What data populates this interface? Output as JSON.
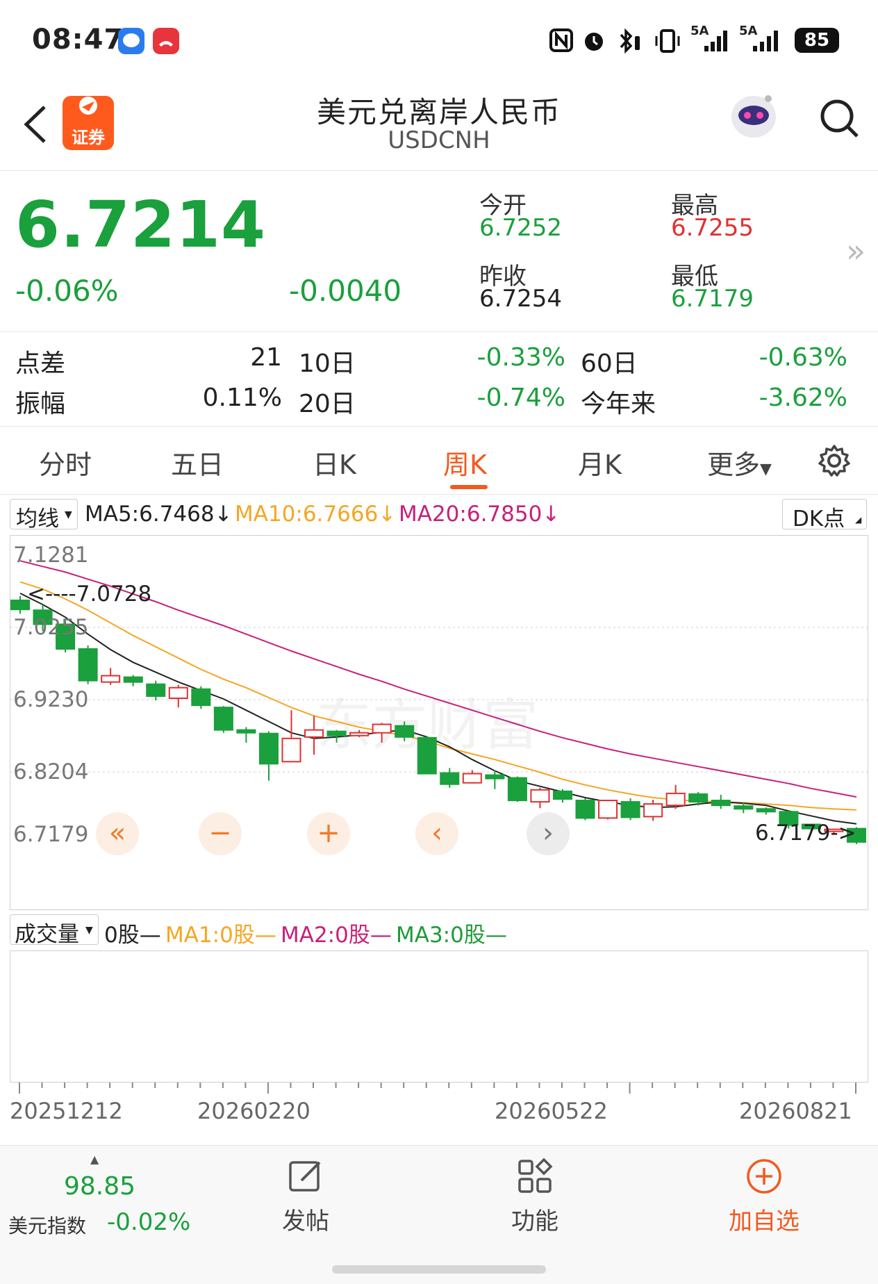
{
  "status": {
    "time": "08:47",
    "battery": "85",
    "signal1": "5A",
    "signal2": "5A"
  },
  "header": {
    "title": "美元兑离岸人民币",
    "subtitle": "USDCNH",
    "logo_text": "证券"
  },
  "quote": {
    "price": "6.7214",
    "change_pct": "-0.06%",
    "change": "-0.0040",
    "open_label": "今开",
    "open": "6.7252",
    "high_label": "最高",
    "high": "6.7255",
    "prev_label": "昨收",
    "prev": "6.7254",
    "low_label": "最低",
    "low": "6.7179"
  },
  "stats": {
    "spread_label": "点差",
    "spread": "21",
    "d10_label": "10日",
    "d10": "-0.33%",
    "d60_label": "60日",
    "d60": "-0.63%",
    "amp_label": "振幅",
    "amp": "0.11%",
    "d20_label": "20日",
    "d20": "-0.74%",
    "ytd_label": "今年来",
    "ytd": "-3.62%"
  },
  "tabs": [
    "分时",
    "五日",
    "日K",
    "周K",
    "月K",
    "更多"
  ],
  "active_tab": "周K",
  "indicators": {
    "select": "均线",
    "ma5": "MA5:6.7468",
    "ma10": "MA10:6.7666",
    "ma20": "MA20:6.7850",
    "dk": "DK点"
  },
  "volume": {
    "select": "成交量",
    "v": "0股—",
    "ma1": "MA1:0股—",
    "ma2": "MA2:0股—",
    "ma3": "MA3:0股—"
  },
  "chart_data": {
    "type": "candlestick",
    "y_ticks": [
      "7.1281",
      "7.0255",
      "6.9230",
      "6.8204",
      "6.7179"
    ],
    "ylim": [
      6.7179,
      7.1281
    ],
    "x_labels": [
      "20251212",
      "20260220",
      "20260522",
      "20260821"
    ],
    "annotations": {
      "max": "<----7.0728",
      "min": "6.7179->"
    },
    "candles": [
      [
        7.064,
        7.051,
        7.07,
        7.045
      ],
      [
        7.05,
        7.03,
        7.058,
        7.02
      ],
      [
        7.03,
        6.995,
        7.035,
        6.99
      ],
      [
        6.995,
        6.95,
        7.0,
        6.945
      ],
      [
        6.948,
        6.957,
        6.968,
        6.944
      ],
      [
        6.955,
        6.948,
        6.958,
        6.942
      ],
      [
        6.945,
        6.928,
        6.95,
        6.922
      ],
      [
        6.925,
        6.94,
        6.944,
        6.912
      ],
      [
        6.938,
        6.915,
        6.942,
        6.91
      ],
      [
        6.912,
        6.88,
        6.914,
        6.876
      ],
      [
        6.88,
        6.876,
        6.884,
        6.862
      ],
      [
        6.875,
        6.832,
        6.878,
        6.808
      ],
      [
        6.835,
        6.868,
        6.908,
        6.835
      ],
      [
        6.87,
        6.88,
        6.9,
        6.845
      ],
      [
        6.878,
        6.872,
        6.88,
        6.862
      ],
      [
        6.872,
        6.876,
        6.88,
        6.87
      ],
      [
        6.876,
        6.888,
        6.89,
        6.862
      ],
      [
        6.886,
        6.87,
        6.892,
        6.864
      ],
      [
        6.869,
        6.818,
        6.871,
        6.817
      ],
      [
        6.819,
        6.803,
        6.826,
        6.798
      ],
      [
        6.805,
        6.818,
        6.823,
        6.804
      ],
      [
        6.816,
        6.811,
        6.823,
        6.796
      ],
      [
        6.812,
        6.78,
        6.814,
        6.778
      ],
      [
        6.778,
        6.795,
        6.798,
        6.769
      ],
      [
        6.793,
        6.782,
        6.796,
        6.777
      ],
      [
        6.78,
        6.755,
        6.783,
        6.752
      ],
      [
        6.755,
        6.78,
        6.781,
        6.753
      ],
      [
        6.778,
        6.756,
        6.783,
        6.752
      ],
      [
        6.757,
        6.775,
        6.781,
        6.751
      ],
      [
        6.773,
        6.79,
        6.802,
        6.768
      ],
      [
        6.789,
        6.778,
        6.792,
        6.773
      ],
      [
        6.78,
        6.773,
        6.788,
        6.768
      ],
      [
        6.772,
        6.768,
        6.777,
        6.762
      ],
      [
        6.768,
        6.764,
        6.77,
        6.76
      ],
      [
        6.764,
        6.745,
        6.765,
        6.74
      ],
      [
        6.746,
        6.74,
        6.746,
        6.737
      ],
      [
        6.737,
        6.739,
        6.74,
        6.733
      ],
      [
        6.74,
        6.721,
        6.742,
        6.718
      ]
    ],
    "ma5": [
      7.074,
      7.058,
      7.04,
      7.016,
      6.994,
      6.976,
      6.962,
      6.948,
      6.936,
      6.924,
      6.908,
      6.892,
      6.876,
      6.868,
      6.87,
      6.873,
      6.877,
      6.88,
      6.87,
      6.856,
      6.838,
      6.822,
      6.808,
      6.8,
      6.792,
      6.784,
      6.778,
      6.773,
      6.77,
      6.771,
      6.775,
      6.778,
      6.776,
      6.773,
      6.765,
      6.758,
      6.751,
      6.7468
    ],
    "ma10": [
      7.09,
      7.08,
      7.066,
      7.05,
      7.032,
      7.014,
      6.998,
      6.982,
      6.966,
      6.952,
      6.94,
      6.926,
      6.912,
      6.9,
      6.892,
      6.884,
      6.878,
      6.872,
      6.864,
      6.854,
      6.846,
      6.838,
      6.829,
      6.82,
      6.81,
      6.802,
      6.795,
      6.789,
      6.784,
      6.781,
      6.779,
      6.778,
      6.777,
      6.775,
      6.773,
      6.77,
      6.768,
      6.7666
    ],
    "ma20": [
      7.12,
      7.112,
      7.104,
      7.094,
      7.084,
      7.073,
      7.062,
      7.05,
      7.039,
      7.028,
      7.016,
      7.004,
      6.992,
      6.981,
      6.97,
      6.959,
      6.949,
      6.938,
      6.928,
      6.918,
      6.908,
      6.898,
      6.888,
      6.878,
      6.869,
      6.861,
      6.853,
      6.846,
      6.84,
      6.834,
      6.828,
      6.822,
      6.816,
      6.81,
      6.804,
      6.797,
      6.791,
      6.785
    ]
  },
  "chart_controls": [
    "«",
    "−",
    "+",
    "‹",
    "›"
  ],
  "bottom": {
    "index_value": "98.85",
    "index_name": "美元指数",
    "index_pct": "-0.02%",
    "post": "发帖",
    "func": "功能",
    "add": "加自选"
  },
  "colors": {
    "up": "#e03030",
    "down": "#1aa03c",
    "accent": "#f25a1e",
    "ma5": "#222222",
    "ma10": "#f5a623",
    "ma20": "#c8207a"
  }
}
